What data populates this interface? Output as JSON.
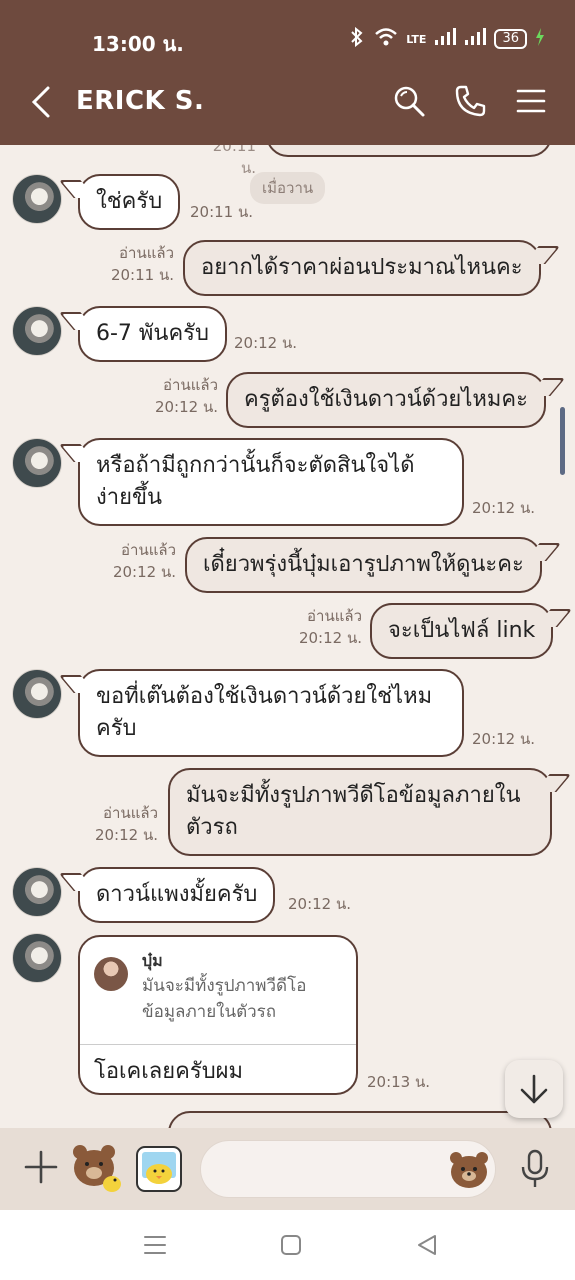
{
  "status": {
    "time": "13:00 น.",
    "network": "LTE",
    "battery": "36"
  },
  "header": {
    "title": "ERICK S."
  },
  "date_chip": "เมื่อวาน",
  "messages": [
    {
      "dir": "in",
      "text": "ใช่ครับ",
      "time": "20:11 น."
    },
    {
      "dir": "out",
      "read": "อ่านแล้ว",
      "text": "อยากได้ราคาผ่อนประมาณไหนคะ",
      "time": "20:11 น."
    },
    {
      "dir": "in",
      "text": "6-7 พันครับ",
      "time": "20:12 น."
    },
    {
      "dir": "out",
      "read": "อ่านแล้ว",
      "text": "ครูต้องใช้เงินดาวน์ด้วยไหมคะ",
      "time": "20:12 น."
    },
    {
      "dir": "in",
      "line1": "หรือถ้ามีถูกกว่านั้นก็จะตัดสินใจได้",
      "line2": "ง่ายขึ้น",
      "time": "20:12 น."
    },
    {
      "dir": "out",
      "read": "อ่านแล้ว",
      "text": "เดี๋ยวพรุ่งนี้บุ๋มเอารูปภาพให้ดูนะคะ",
      "time": "20:12 น."
    },
    {
      "dir": "out",
      "read": "อ่านแล้ว",
      "text": "จะเป็นไฟล์ link",
      "time": "20:12 น."
    },
    {
      "dir": "in",
      "line1": "ขอที่เต๊นต้องใช้เงินดาวน์ด้วยใช่ไหม",
      "line2": "ครับ",
      "time": "20:12 น."
    },
    {
      "dir": "out",
      "read": "อ่านแล้ว",
      "line1": "มันจะมีทั้งรูปภาพวีดีโอข้อมูลภายใน",
      "line2": "ตัวรถ",
      "time": "20:12 น."
    },
    {
      "dir": "in",
      "text": "ดาวน์แพงมั้ยครับ",
      "time": "20:12 น."
    },
    {
      "dir": "in",
      "reply_name": "บุ๋ม",
      "reply_text": "มันจะมีทั้งรูปภาพวีดีโอข้อมูลภายในตัวรถ",
      "text": "โอเคเลยครับผม",
      "time": "20:13 น."
    }
  ]
}
